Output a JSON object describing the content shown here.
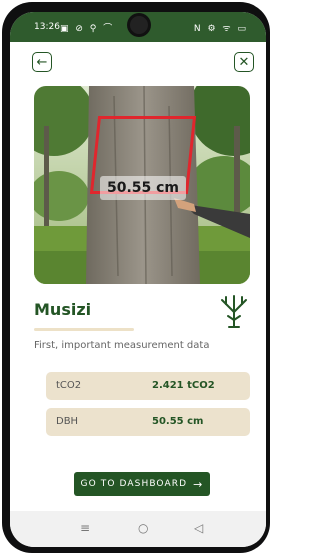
{
  "status_bar": {
    "time": "13:26",
    "left_icons": "▣ ⊘ ⚲ ⌒",
    "right_icons": "N ⚙ ᯤ ▭"
  },
  "header": {
    "back_icon": "arrow-left-icon",
    "close_icon": "close-icon"
  },
  "photo": {
    "measurement_label": "50.55 cm",
    "overlay_color": "#e0262d"
  },
  "species": {
    "name": "Musizi",
    "icon": "tree-icon"
  },
  "subtitle": "First, important measurement data",
  "metrics": [
    {
      "label": "tCO2",
      "value": "2.421 tCO2"
    },
    {
      "label": "DBH",
      "value": "50.55 cm"
    }
  ],
  "dashboard_button": {
    "label": "GO TO DASHBOARD",
    "arrow": "→"
  },
  "nav_bar": {
    "recents": "≡",
    "home": "○",
    "back": "◁"
  },
  "colors": {
    "primary": "#245525",
    "status_bar": "#2f5b2d",
    "metric_bg": "#ece2cd",
    "measure_red": "#e0262d"
  }
}
